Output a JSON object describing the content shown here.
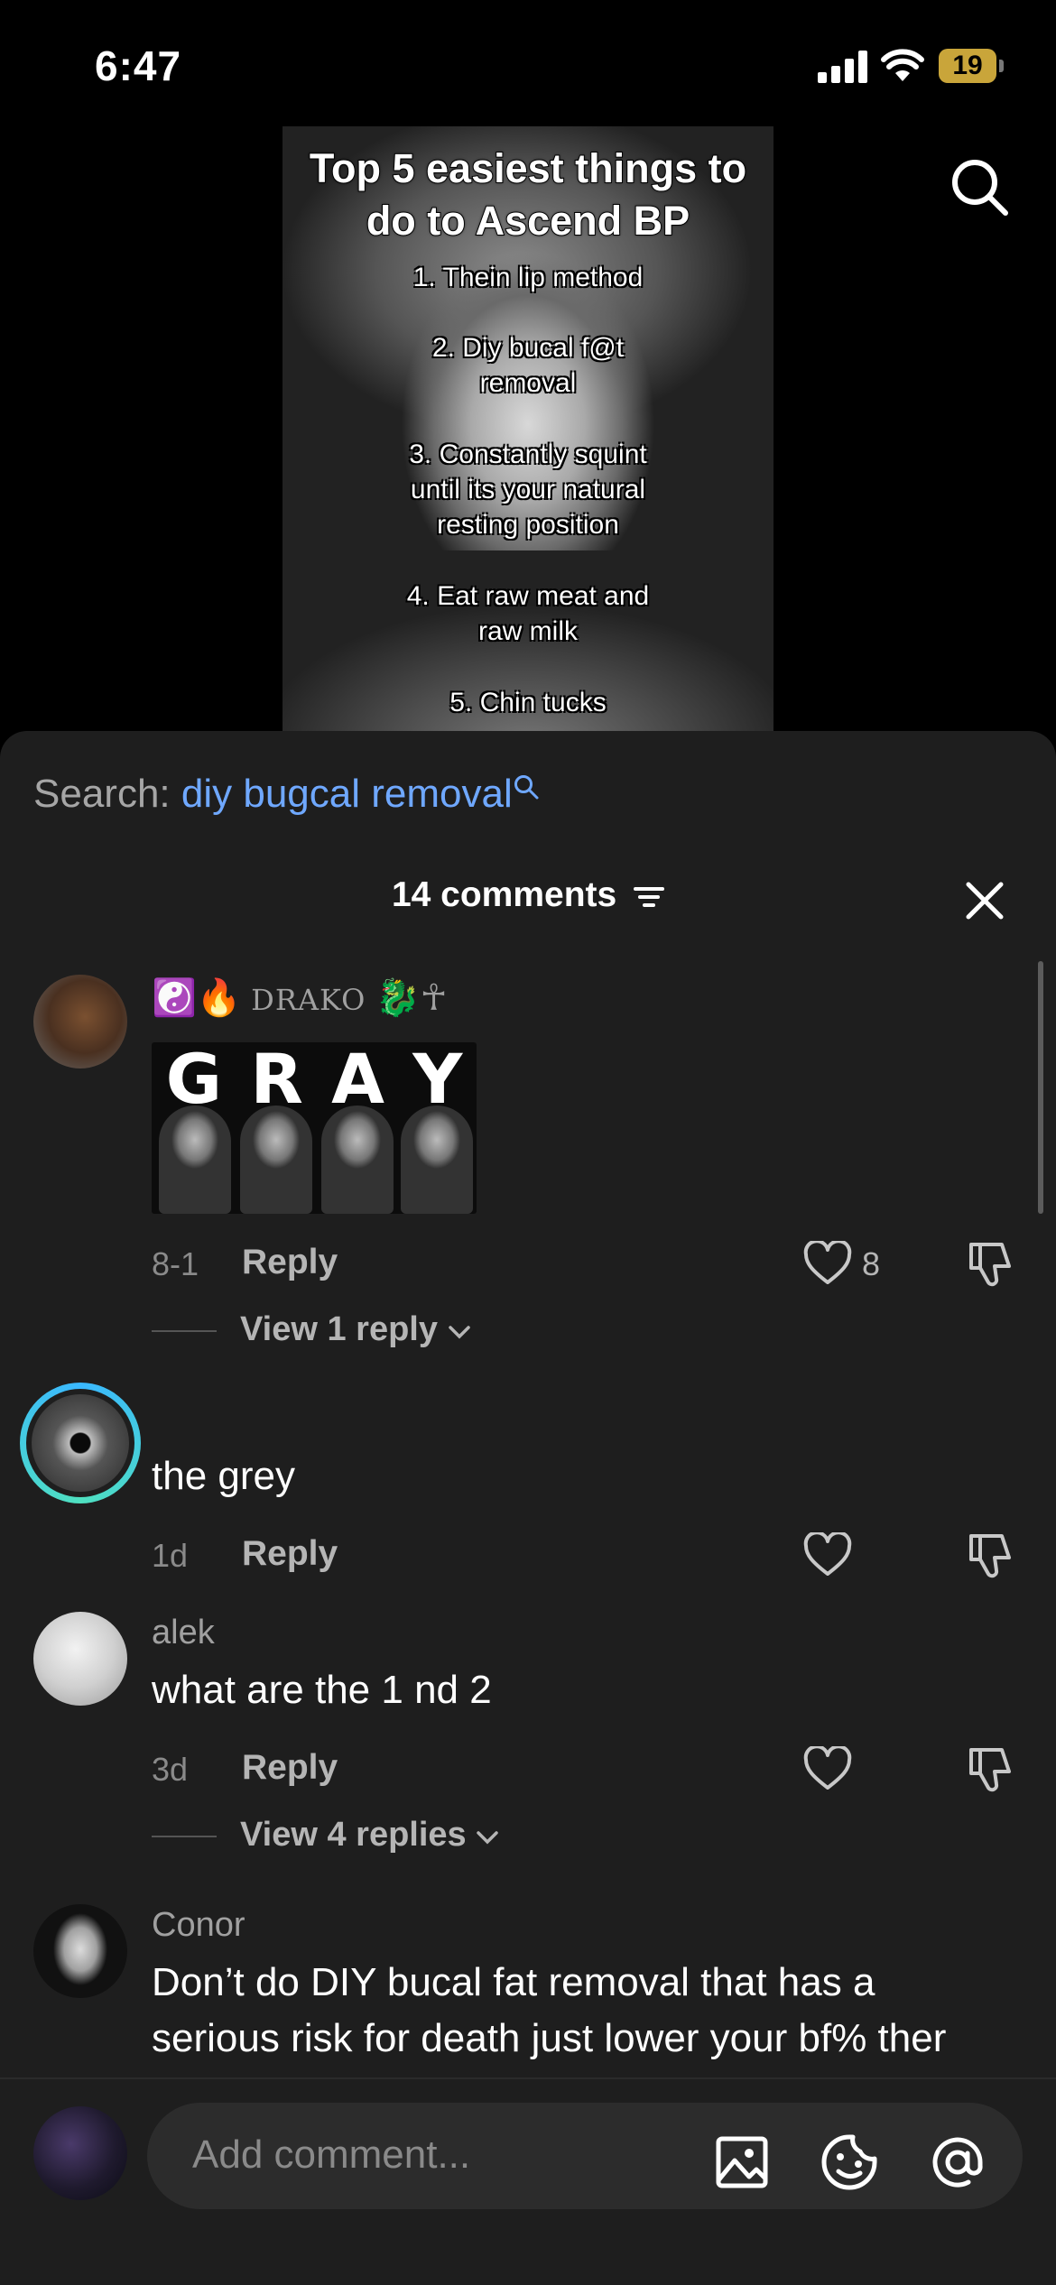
{
  "status_bar": {
    "time": "6:47",
    "battery": "19"
  },
  "video": {
    "title_lines": [
      "Top 5 easiest things to",
      "do to Ascend BP"
    ],
    "items": [
      [
        "1. Thein lip method"
      ],
      [
        "2. Diy bucal f@t",
        "removal"
      ],
      [
        "3. Constantly squint",
        "until its your natural",
        "resting position"
      ],
      [
        "4. Eat raw meat and",
        "raw milk"
      ],
      [
        "5. Chin tucks"
      ]
    ]
  },
  "search_hint": {
    "label": "Search:",
    "query": "diy bugcal removal"
  },
  "comments_header": {
    "count_label": "14 comments"
  },
  "comments": [
    {
      "username": "DRAKO",
      "emoji_prefix": "☯️🔥",
      "emoji_suffix": "🐉☥",
      "image_text": [
        "G",
        "R",
        "A",
        "Y"
      ],
      "time": "8-1",
      "reply_label": "Reply",
      "likes": "8",
      "view_replies": "View 1 reply"
    },
    {
      "username": "",
      "text": "the grey",
      "time": "1d",
      "reply_label": "Reply"
    },
    {
      "username": "alek",
      "text": "what are the 1 nd 2",
      "time": "3d",
      "reply_label": "Reply",
      "view_replies": "View 4 replies"
    },
    {
      "username": "Conor",
      "text_lines": [
        "Don’t do DIY bucal fat removal that has a",
        "serious risk for death just lower your bf% ther"
      ]
    }
  ],
  "composer": {
    "placeholder": "Add comment..."
  },
  "colors": {
    "accent": "#6fa8ff",
    "sheet_bg": "#1e1e1e",
    "input_bg": "#2c2c2c",
    "battery": "#c9a53a"
  },
  "icons": [
    "search-icon",
    "filter-icon",
    "close-icon",
    "heart-icon",
    "dislike-icon",
    "chevron-down-icon",
    "image-icon",
    "sticker-icon",
    "mention-icon"
  ]
}
